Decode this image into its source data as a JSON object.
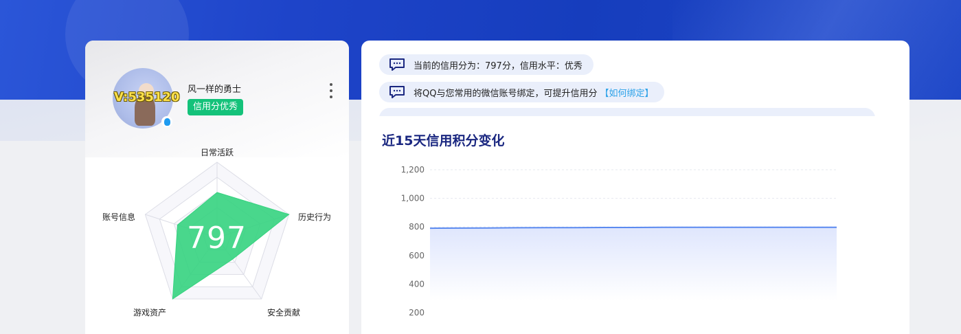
{
  "profile": {
    "username": "风一样的勇士",
    "vip_text": "V:535120",
    "credit_badge": "信用分优秀",
    "score": "797"
  },
  "radar": {
    "labels": [
      "日常活跃",
      "历史行为",
      "安全贡献",
      "游戏资产",
      "账号信息"
    ],
    "values": [
      0.6,
      1.0,
      0.35,
      1.0,
      0.55
    ],
    "levels": 5,
    "fill_color": "#35d37f"
  },
  "notices": [
    {
      "text": "当前的信用分为：797分，信用水平：优秀",
      "link": ""
    },
    {
      "text": "将QQ与您常用的微信账号绑定，可提升信用分",
      "link": "【如何绑定】"
    }
  ],
  "colors": {
    "accent": "#1a2780",
    "line": "#5b8af0",
    "badge": "#14c27a",
    "link": "#2aa1e8"
  },
  "chart_data": {
    "type": "area",
    "title": "近15天信用积分变化",
    "xlabel": "",
    "ylabel": "",
    "ylim": [
      200,
      1200
    ],
    "yticks": [
      "200",
      "400",
      "600",
      "800",
      "1,000",
      "1,200"
    ],
    "ytick_values": [
      200,
      400,
      600,
      800,
      1000,
      1200
    ],
    "grid": true,
    "series": [
      {
        "values": [
          791,
          792,
          793,
          794,
          795,
          795,
          796,
          796,
          797,
          797,
          797,
          797,
          797,
          797,
          797
        ]
      }
    ]
  }
}
